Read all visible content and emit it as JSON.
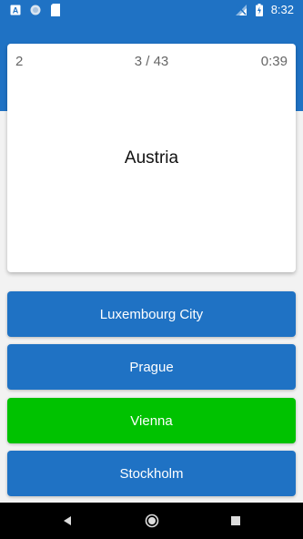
{
  "status_bar": {
    "time": "8:32",
    "icons": [
      "a-notification-icon",
      "circle-notification-icon",
      "sd-card-icon",
      "signal-icon",
      "battery-charging-icon"
    ]
  },
  "quiz": {
    "score": "2",
    "progress": "3 / 43",
    "timer": "0:39",
    "question": "Austria"
  },
  "answers": [
    {
      "label": "Luxembourg City",
      "color": "#1f72c4"
    },
    {
      "label": "Prague",
      "color": "#1f72c4"
    },
    {
      "label": "Vienna",
      "color": "#00c200"
    },
    {
      "label": "Stockholm",
      "color": "#1f72c4"
    }
  ],
  "nav": {
    "icons": [
      "back-icon",
      "home-icon",
      "recents-icon"
    ]
  },
  "colors": {
    "primary": "#1f72c4",
    "correct": "#00c200",
    "nav_background": "#000000"
  }
}
